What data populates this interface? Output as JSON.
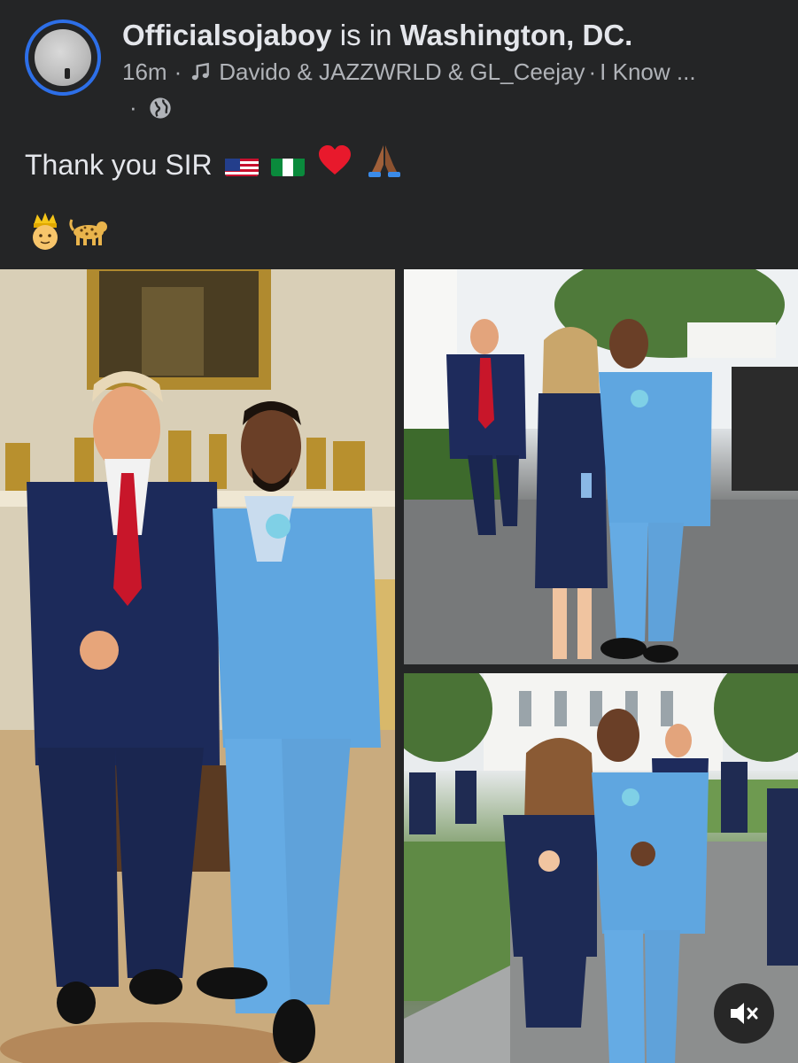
{
  "post": {
    "author": "Officialsojaboy",
    "connector": " is in ",
    "location": "Washington, DC.",
    "time": "16m",
    "separator": "·",
    "song": "Davido & JAZZWRLD & GL_Ceejay",
    "song_title": "I Know ...",
    "text": "Thank you SIR"
  },
  "icons": {
    "music": "music-note-icon",
    "globe": "globe-icon",
    "mute": "speaker-muted-icon"
  },
  "colors": {
    "background": "#242526",
    "avatar_ring": "#2d6fe8",
    "text_primary": "#e4e6eb",
    "text_secondary": "#b0b3b8"
  }
}
